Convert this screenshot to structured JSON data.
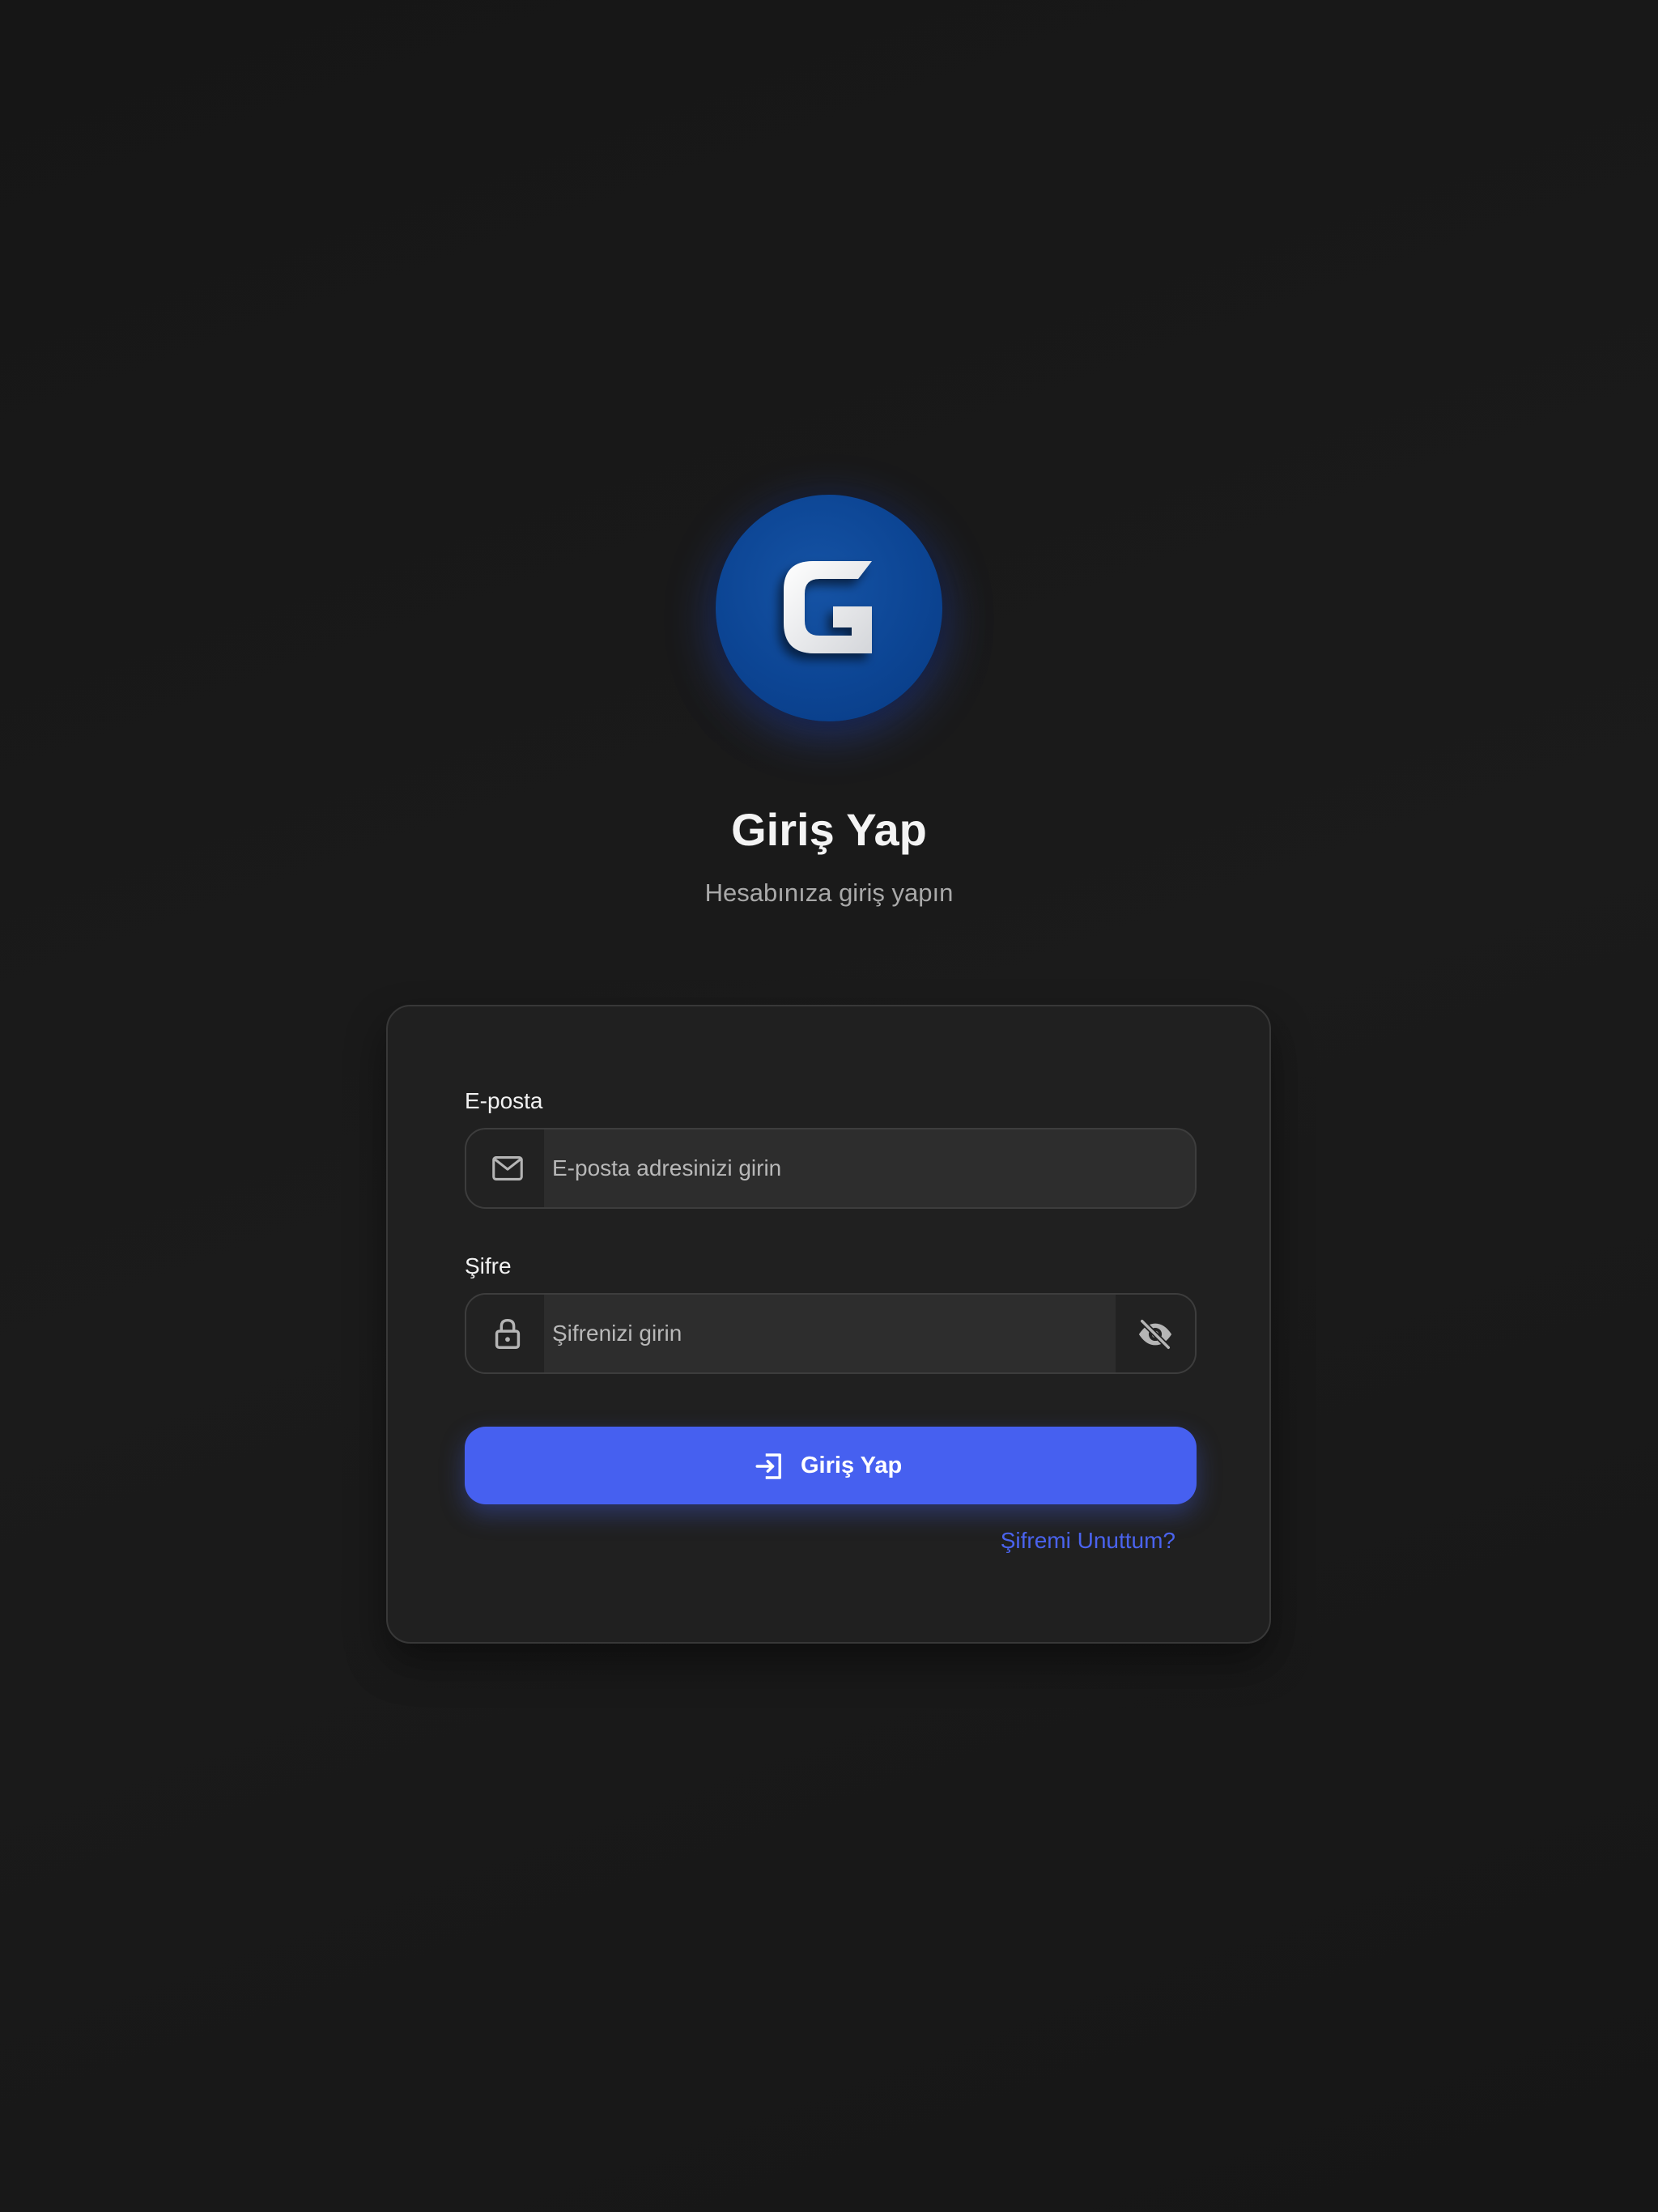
{
  "logo": {
    "icon": "g-letter-logo",
    "background": "#0c4594"
  },
  "header": {
    "title": "Giriş Yap",
    "subtitle": "Hesabınıza giriş yapın"
  },
  "form": {
    "email": {
      "label": "E-posta",
      "placeholder": "E-posta adresinizi girin",
      "value": "",
      "icon": "mail-icon"
    },
    "password": {
      "label": "Şifre",
      "placeholder": "Şifrenizi girin",
      "value": "",
      "icon": "lock-icon",
      "toggle_icon": "eye-off-icon"
    },
    "submit": {
      "label": "Giriş Yap",
      "icon": "login-icon"
    },
    "forgot_link": "Şifremi Unuttum?"
  },
  "colors": {
    "accent": "#4660f0",
    "link": "#4a63ee",
    "background": "#181818",
    "card": "#202020"
  }
}
